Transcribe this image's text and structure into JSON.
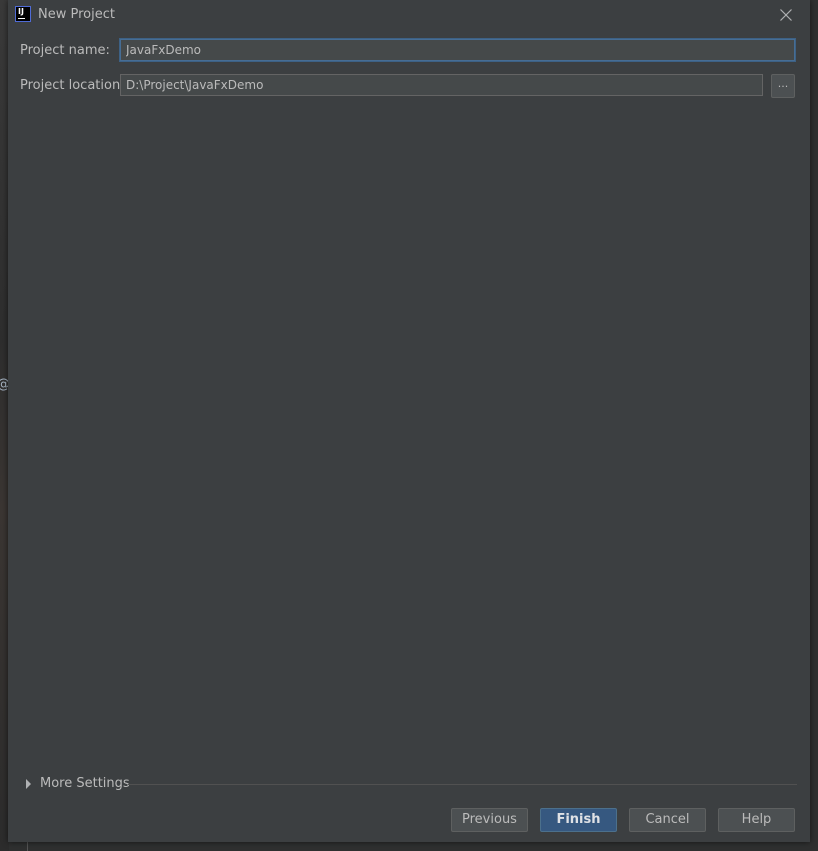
{
  "window": {
    "title": "New Project",
    "logo_text": "IJ"
  },
  "form": {
    "project_name_label": "Project name:",
    "project_name_value": "JavaFxDemo",
    "project_location_label": "Project location:",
    "project_location_value": "D:\\Project\\JavaFxDemo",
    "browse_label": "..."
  },
  "more_settings": {
    "label": "More Settings"
  },
  "buttons": {
    "previous": "Previous",
    "finish": "Finish",
    "cancel": "Cancel",
    "help": "Help"
  },
  "backdrop": {
    "fragment": "@"
  },
  "colors": {
    "dialog_bg": "#3c3f41",
    "field_bg": "#45494a",
    "focus_border": "#466d94",
    "primary_button": "#365880",
    "text": "#bbbbbb"
  }
}
